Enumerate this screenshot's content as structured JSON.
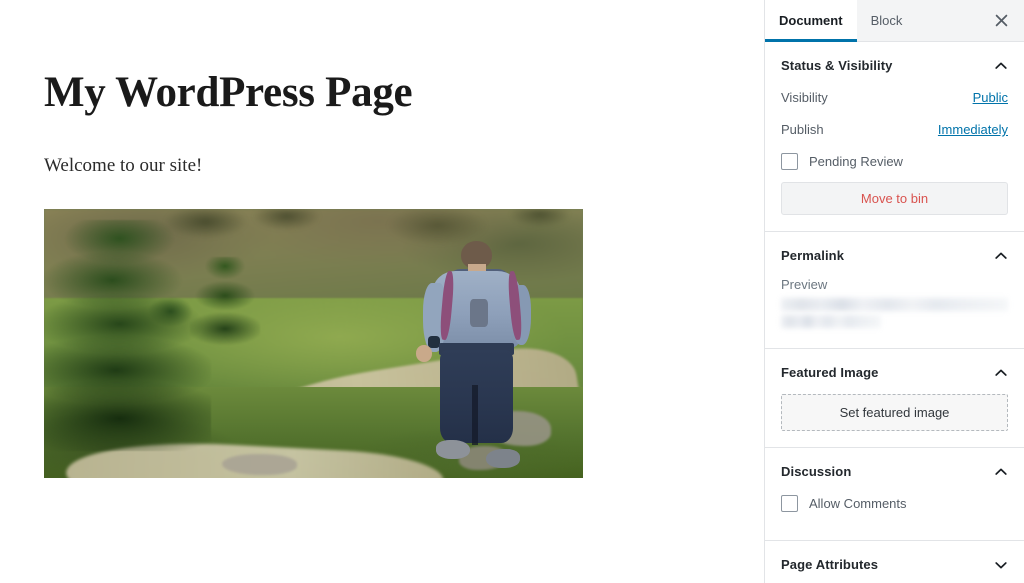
{
  "editor": {
    "title": "My WordPress Page",
    "paragraph": "Welcome to our site!",
    "image_block": {
      "name": "hiker-on-mountain-trail-photo",
      "alt": "Person with backpack walking on a dirt trail through a green hillside with conifer trees"
    }
  },
  "sidebar": {
    "tabs": [
      {
        "label": "Document",
        "active": true
      },
      {
        "label": "Block",
        "active": false
      }
    ],
    "close_icon": "close-icon",
    "panels": [
      {
        "title": "Status & Visibility",
        "expanded": true,
        "chevron": "chevron-up-icon",
        "rows": [
          {
            "label": "Visibility",
            "value": "Public"
          },
          {
            "label": "Publish",
            "value": "Immediately"
          }
        ],
        "checkbox": {
          "label": "Pending Review",
          "checked": false
        },
        "button": {
          "label": "Move to bin",
          "color": "#d9534f"
        }
      },
      {
        "title": "Permalink",
        "expanded": true,
        "chevron": "chevron-up-icon",
        "preview_label": "Preview",
        "preview_value_redacted": true
      },
      {
        "title": "Featured Image",
        "expanded": true,
        "chevron": "chevron-up-icon",
        "button": {
          "label": "Set featured image"
        }
      },
      {
        "title": "Discussion",
        "expanded": true,
        "chevron": "chevron-up-icon",
        "checkbox": {
          "label": "Allow Comments",
          "checked": false
        }
      },
      {
        "title": "Page Attributes",
        "expanded": false,
        "chevron": "chevron-down-icon"
      }
    ]
  },
  "colors": {
    "accent_blue": "#0073aa",
    "link_blue": "#0073aa",
    "danger_red": "#d9534f",
    "panel_border": "#e2e4e7",
    "tabbar_bg": "#f3f4f5",
    "heading_text": "#23282d",
    "muted_text": "#555d66"
  }
}
